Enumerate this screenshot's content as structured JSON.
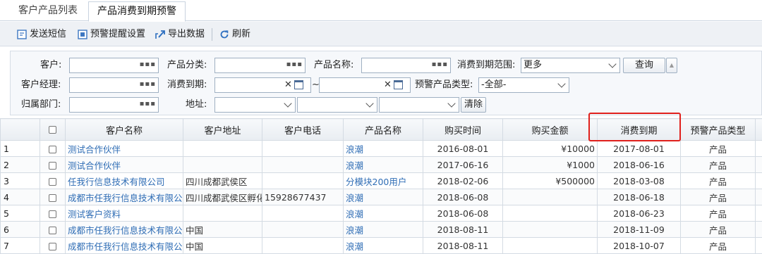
{
  "tabs": [
    {
      "label": "客户产品列表"
    },
    {
      "label": "产品消费到期预警"
    }
  ],
  "toolbar": {
    "send_sms": "发送短信",
    "alert_settings": "预警提醒设置",
    "export": "导出数据",
    "refresh": "刷新"
  },
  "filters": {
    "customer_label": "客户:",
    "category_label": "产品分类:",
    "product_name_label": "产品名称:",
    "expiry_range_label": "消费到期范围:",
    "expiry_range_value": "更多",
    "query_button": "查询",
    "manager_label": "客户经理:",
    "expiry_label": "消费到期:",
    "expiry_sep": "~",
    "warning_type_label": "预警产品类型:",
    "warning_type_value": "-全部-",
    "dept_label": "归属部门:",
    "address_label": "地址:",
    "clear_button": "清除"
  },
  "table": {
    "headers": [
      "客户名称",
      "客户地址",
      "客户电话",
      "产品名称",
      "购买时间",
      "购买金额",
      "消费到期",
      "预警产品类型"
    ],
    "rows": [
      {
        "n": "1",
        "name": "测试合作伙伴",
        "addr": "",
        "phone": "",
        "product": "浪潮",
        "buy": "2016-08-01",
        "amount": "¥10000",
        "expiry": "2017-08-01",
        "type": "产品"
      },
      {
        "n": "2",
        "name": "测试合作伙伴",
        "addr": "",
        "phone": "",
        "product": "浪潮",
        "buy": "2017-06-16",
        "amount": "¥1000",
        "expiry": "2018-06-16",
        "type": "产品"
      },
      {
        "n": "3",
        "name": "任我行信息技术有限公司",
        "addr": "四川成都武侯区",
        "phone": "",
        "product": "分模块200用户",
        "buy": "2018-02-06",
        "amount": "¥500000",
        "expiry": "2018-03-08",
        "type": "产品"
      },
      {
        "n": "4",
        "name": "成都市任我行信息技术有限公",
        "addr": "四川成都武侯区孵化",
        "phone": "15928677437",
        "product": "浪潮",
        "buy": "2018-06-08",
        "amount": "",
        "expiry": "2018-06-18",
        "type": "产品"
      },
      {
        "n": "5",
        "name": "测试客户资料",
        "addr": "",
        "phone": "",
        "product": "浪潮",
        "buy": "2018-06-08",
        "amount": "",
        "expiry": "2018-06-23",
        "type": "产品"
      },
      {
        "n": "6",
        "name": "成都市任我行信息技术有限公",
        "addr": "中国",
        "phone": "",
        "product": "浪潮",
        "buy": "2018-08-11",
        "amount": "",
        "expiry": "2018-11-09",
        "type": "产品"
      },
      {
        "n": "7",
        "name": "成都市任我行信息技术有限公",
        "addr": "中国",
        "phone": "",
        "product": "浪潮",
        "buy": "2018-08-11",
        "amount": "",
        "expiry": "2018-10-07",
        "type": "产品"
      }
    ]
  },
  "colors": {
    "link": "#2f6db5",
    "highlight": "#e0201c"
  }
}
